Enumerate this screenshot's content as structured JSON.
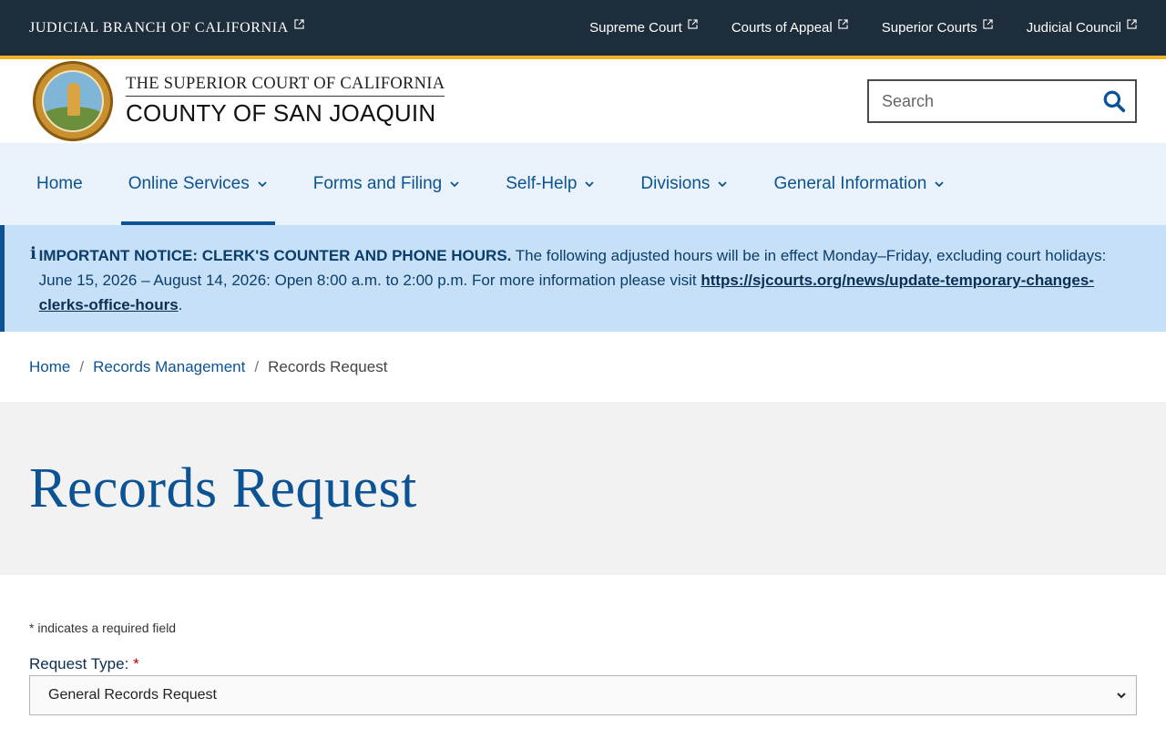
{
  "topbar": {
    "branch": "JUDICIAL BRANCH OF CALIFORNIA",
    "links": [
      "Supreme Court",
      "Courts of Appeal",
      "Superior Courts",
      "Judicial Council"
    ]
  },
  "header": {
    "line1": "THE SUPERIOR COURT OF CALIFORNIA",
    "line2": "COUNTY OF SAN JOAQUIN",
    "search_placeholder": "Search"
  },
  "nav": {
    "items": [
      "Home",
      "Online Services",
      "Forms and Filing",
      "Self-Help",
      "Divisions",
      "General Information"
    ]
  },
  "notice": {
    "icon": "info-icon",
    "heading": "IMPORTANT NOTICE: CLERK'S COUNTER AND PHONE HOURS.",
    "text": " The following adjusted hours will be in effect Monday–Friday, excluding court holidays: June 15, 2026 – August 14, 2026: Open 8:00 a.m. to 2:00 p.m. For more information please visit ",
    "link": "https://sjcourts.org/news/update-temporary-changes-clerks-office-hours",
    "trailing": "."
  },
  "breadcrumb": {
    "items": [
      "Home",
      "Records Management"
    ],
    "sep": "/",
    "current": "Records Request"
  },
  "page_title": "Records Request",
  "form": {
    "required_note": "* indicates a required field",
    "request_type_label": "Request Type:",
    "required_star": "*",
    "request_type_value": "General Records Request"
  },
  "colors": {
    "topbar_bg": "#1e2d3b",
    "accent_gold": "#f0b323",
    "brand_blue": "#0b5394",
    "nav_bg": "#eaf3fb",
    "notice_bg": "#c6e1f7"
  }
}
